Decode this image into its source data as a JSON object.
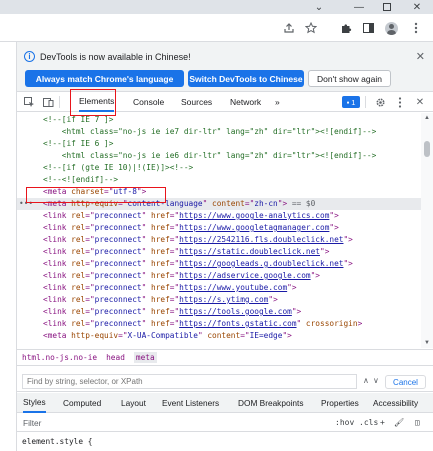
{
  "browser": {
    "window_controls": {
      "chevron": "⌄",
      "minimize": "—",
      "close": "✕"
    },
    "toolbar_icons": [
      "share-icon",
      "star-icon",
      "extensions-icon",
      "side-panel-icon",
      "profile-icon",
      "menu-icon"
    ]
  },
  "notice": {
    "message": "DevTools is now available in Chinese!",
    "buttons": {
      "match_language": "Always match Chrome's language",
      "switch_language": "Switch DevTools to Chinese",
      "dont_show": "Don't show again"
    }
  },
  "tabs": {
    "items": [
      "Elements",
      "Console",
      "Sources",
      "Network"
    ],
    "more": "»",
    "issues_count": "1",
    "active": "Elements"
  },
  "code_lines": [
    {
      "gutter": "",
      "parts": [
        [
          "cmt",
          "<!--[if IE 7 ]>"
        ]
      ]
    },
    {
      "gutter": "",
      "parts": [
        [
          "cmt",
          "    <html class=\"no-js ie ie7 dir-ltr\" lang=\"zh\" dir=\"ltr\"><![endif]-->"
        ]
      ]
    },
    {
      "gutter": "",
      "parts": [
        [
          "cmt",
          "<!--[if IE 6 ]>"
        ]
      ]
    },
    {
      "gutter": "",
      "parts": [
        [
          "cmt",
          "    <html class=\"no-js ie ie6 dir-ltr\" lang=\"zh\" dir=\"ltr\"><![endif]-->"
        ]
      ]
    },
    {
      "gutter": "",
      "parts": [
        [
          "cmt",
          "<!--[if (gte IE 10)|!(IE)]><!-->"
        ]
      ]
    },
    {
      "gutter": "",
      "parts": [
        [
          "cmt",
          "<!--<![endif]-->"
        ]
      ]
    },
    {
      "gutter": "",
      "parts": [
        [
          "tag",
          "<meta "
        ],
        [
          "attr",
          "charset"
        ],
        [
          "tag",
          "=\""
        ],
        [
          "val",
          "utf-8"
        ],
        [
          "tag",
          "\">"
        ]
      ]
    },
    {
      "gutter": "•••",
      "parts": [
        [
          "tag",
          "<meta "
        ],
        [
          "attr",
          "http-equiv"
        ],
        [
          "tag",
          "=\""
        ],
        [
          "val",
          "content-language"
        ],
        [
          "tag",
          "\" "
        ],
        [
          "attr",
          "content"
        ],
        [
          "tag",
          "=\""
        ],
        [
          "val",
          "zh-cn"
        ],
        [
          "tag",
          "\">"
        ],
        [
          "dim",
          " == $0"
        ]
      ]
    },
    {
      "gutter": "",
      "parts": [
        [
          "tag",
          "<link "
        ],
        [
          "attr",
          "rel"
        ],
        [
          "tag",
          "=\""
        ],
        [
          "val",
          "preconnect"
        ],
        [
          "tag",
          "\" "
        ],
        [
          "attr",
          "href"
        ],
        [
          "tag",
          "=\""
        ],
        [
          "link",
          "https://www.google-analytics.com"
        ],
        [
          "tag",
          "\">"
        ]
      ]
    },
    {
      "gutter": "",
      "parts": [
        [
          "tag",
          "<link "
        ],
        [
          "attr",
          "rel"
        ],
        [
          "tag",
          "=\""
        ],
        [
          "val",
          "preconnect"
        ],
        [
          "tag",
          "\" "
        ],
        [
          "attr",
          "href"
        ],
        [
          "tag",
          "=\""
        ],
        [
          "link",
          "https://www.googletagmanager.com"
        ],
        [
          "tag",
          "\">"
        ]
      ]
    },
    {
      "gutter": "",
      "parts": [
        [
          "tag",
          "<link "
        ],
        [
          "attr",
          "rel"
        ],
        [
          "tag",
          "=\""
        ],
        [
          "val",
          "preconnect"
        ],
        [
          "tag",
          "\" "
        ],
        [
          "attr",
          "href"
        ],
        [
          "tag",
          "=\""
        ],
        [
          "link",
          "https://2542116.fls.doubleclick.net"
        ],
        [
          "tag",
          "\">"
        ]
      ]
    },
    {
      "gutter": "",
      "parts": [
        [
          "tag",
          "<link "
        ],
        [
          "attr",
          "rel"
        ],
        [
          "tag",
          "=\""
        ],
        [
          "val",
          "preconnect"
        ],
        [
          "tag",
          "\" "
        ],
        [
          "attr",
          "href"
        ],
        [
          "tag",
          "=\""
        ],
        [
          "link",
          "https://static.doubleclick.net"
        ],
        [
          "tag",
          "\">"
        ]
      ]
    },
    {
      "gutter": "",
      "parts": [
        [
          "tag",
          "<link "
        ],
        [
          "attr",
          "rel"
        ],
        [
          "tag",
          "=\""
        ],
        [
          "val",
          "preconnect"
        ],
        [
          "tag",
          "\" "
        ],
        [
          "attr",
          "href"
        ],
        [
          "tag",
          "=\""
        ],
        [
          "link",
          "https://googleads.g.doubleclick.net"
        ],
        [
          "tag",
          "\">"
        ]
      ]
    },
    {
      "gutter": "",
      "parts": [
        [
          "tag",
          "<link "
        ],
        [
          "attr",
          "rel"
        ],
        [
          "tag",
          "=\""
        ],
        [
          "val",
          "preconnect"
        ],
        [
          "tag",
          "\" "
        ],
        [
          "attr",
          "href"
        ],
        [
          "tag",
          "=\""
        ],
        [
          "link",
          "https://adservice.google.com"
        ],
        [
          "tag",
          "\">"
        ]
      ]
    },
    {
      "gutter": "",
      "parts": [
        [
          "tag",
          "<link "
        ],
        [
          "attr",
          "rel"
        ],
        [
          "tag",
          "=\""
        ],
        [
          "val",
          "preconnect"
        ],
        [
          "tag",
          "\" "
        ],
        [
          "attr",
          "href"
        ],
        [
          "tag",
          "=\""
        ],
        [
          "link",
          "https://www.youtube.com"
        ],
        [
          "tag",
          "\">"
        ]
      ]
    },
    {
      "gutter": "",
      "parts": [
        [
          "tag",
          "<link "
        ],
        [
          "attr",
          "rel"
        ],
        [
          "tag",
          "=\""
        ],
        [
          "val",
          "preconnect"
        ],
        [
          "tag",
          "\" "
        ],
        [
          "attr",
          "href"
        ],
        [
          "tag",
          "=\""
        ],
        [
          "link",
          "https://s.ytimg.com"
        ],
        [
          "tag",
          "\">"
        ]
      ]
    },
    {
      "gutter": "",
      "parts": [
        [
          "tag",
          "<link "
        ],
        [
          "attr",
          "rel"
        ],
        [
          "tag",
          "=\""
        ],
        [
          "val",
          "preconnect"
        ],
        [
          "tag",
          "\" "
        ],
        [
          "attr",
          "href"
        ],
        [
          "tag",
          "=\""
        ],
        [
          "link",
          "https://tools.google.com"
        ],
        [
          "tag",
          "\">"
        ]
      ]
    },
    {
      "gutter": "",
      "parts": [
        [
          "tag",
          "<link "
        ],
        [
          "attr",
          "rel"
        ],
        [
          "tag",
          "=\""
        ],
        [
          "val",
          "preconnect"
        ],
        [
          "tag",
          "\" "
        ],
        [
          "attr",
          "href"
        ],
        [
          "tag",
          "=\""
        ],
        [
          "link",
          "https://fonts.gstatic.com"
        ],
        [
          "tag",
          "\" "
        ],
        [
          "attr",
          "crossorigin"
        ],
        [
          "tag",
          ">"
        ]
      ]
    },
    {
      "gutter": "",
      "parts": [
        [
          "tag",
          "<meta "
        ],
        [
          "attr",
          "http-equiv"
        ],
        [
          "tag",
          "=\""
        ],
        [
          "val",
          "X-UA-Compatible"
        ],
        [
          "tag",
          "\" "
        ],
        [
          "attr",
          "content"
        ],
        [
          "tag",
          "=\""
        ],
        [
          "val",
          "IE=edge"
        ],
        [
          "tag",
          "\">"
        ]
      ]
    }
  ],
  "breadcrumbs": [
    "html.no-js.no-ie",
    "head",
    "meta"
  ],
  "find": {
    "placeholder": "Find by string, selector, or XPath",
    "cancel": "Cancel"
  },
  "subtabs": [
    "Styles",
    "Computed",
    "Layout",
    "Event Listeners",
    "DOM Breakpoints",
    "Properties",
    "Accessibility"
  ],
  "filter": {
    "placeholder": "Filter",
    "hov": ":hov",
    "cls": ".cls",
    "add": "+"
  },
  "styles_line": "element.style {",
  "colors": {
    "accent": "#1a73e8",
    "highlight": "#e8141b",
    "tag": "#881280",
    "attr": "#994500",
    "comment": "#236e25"
  }
}
